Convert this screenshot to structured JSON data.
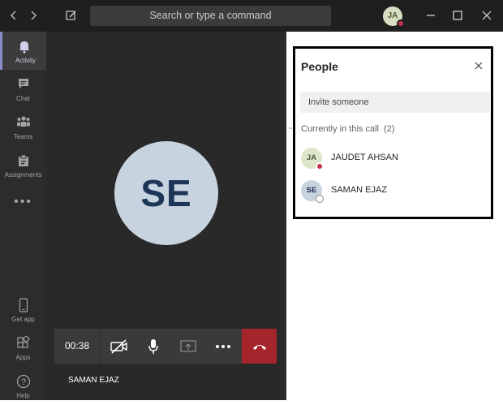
{
  "titlebar": {
    "search_placeholder": "Search or type a command",
    "user_initials": "JA",
    "back_icon": "chevron-left-icon",
    "forward_icon": "chevron-right-icon",
    "compose_icon": "compose-icon"
  },
  "rail": {
    "items": [
      {
        "label": "Activity",
        "icon": "bell-icon",
        "active": true
      },
      {
        "label": "Chat",
        "icon": "chat-icon"
      },
      {
        "label": "Teams",
        "icon": "teams-icon"
      },
      {
        "label": "Assignments",
        "icon": "assignments-icon"
      }
    ],
    "more": "•••",
    "bottom_items": [
      {
        "label": "Get app",
        "icon": "phone-icon"
      },
      {
        "label": "Apps",
        "icon": "apps-icon"
      },
      {
        "label": "Help",
        "icon": "help-icon"
      }
    ]
  },
  "call": {
    "avatar_initials": "SE",
    "timer": "00:38",
    "participant_name": "SAMAN EJAZ"
  },
  "people_panel": {
    "title": "People",
    "invite_placeholder": "Invite someone",
    "current_label": "Currently in this call",
    "current_count": "(2)",
    "participants": [
      {
        "initials": "JA",
        "name": "JAUDET AHSAN",
        "status": "busy"
      },
      {
        "initials": "SE",
        "name": "SAMAN EJAZ",
        "status": "offline"
      }
    ]
  },
  "colors": {
    "hangup": "#a4262c",
    "accent": "#8b8cc7",
    "busy": "#c4314b"
  }
}
